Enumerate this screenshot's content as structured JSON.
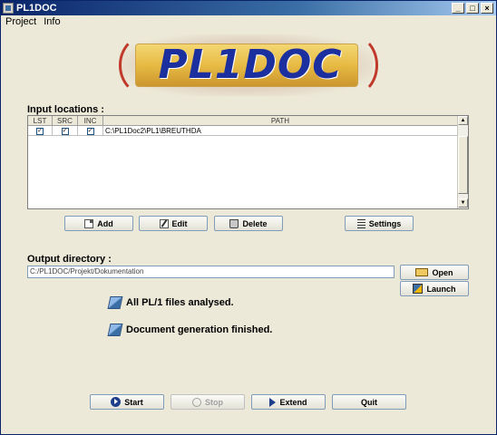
{
  "window": {
    "title": "PL1DOC",
    "controls": [
      "_",
      "□",
      "×"
    ]
  },
  "menu": {
    "items": [
      "Project",
      "Info"
    ]
  },
  "logo": {
    "text": "PL1DOC"
  },
  "input": {
    "label": "Input locations :",
    "columns": [
      "LST",
      "SRC",
      "INC",
      "PATH"
    ],
    "rows": [
      {
        "lst": true,
        "src": true,
        "inc": true,
        "path": "C:\\PL1Doc2\\PL1\\BREUTHDA"
      }
    ],
    "buttons": {
      "add": "Add",
      "edit": "Edit",
      "delete": "Delete",
      "settings": "Settings"
    }
  },
  "output": {
    "label": "Output directory :",
    "value": "C:/PL1DOC/Projekt/Dokumentation",
    "buttons": {
      "open": "Open",
      "launch": "Launch"
    }
  },
  "status": {
    "analysed": "All PL/1 files analysed.",
    "generated": "Document generation finished."
  },
  "actions": {
    "start": "Start",
    "stop": "Stop",
    "extend": "Extend",
    "quit": "Quit"
  }
}
